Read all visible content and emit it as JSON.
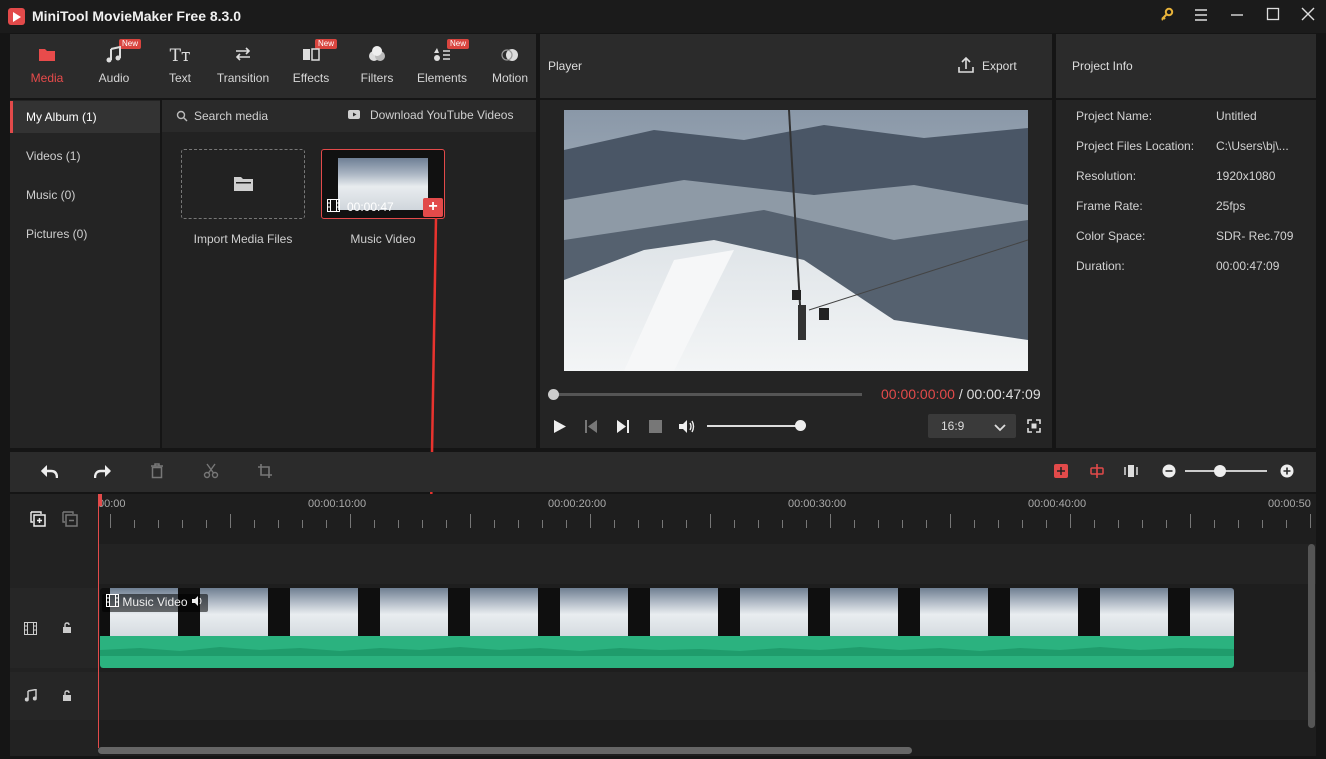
{
  "window": {
    "title": "MiniTool MovieMaker Free 8.3.0"
  },
  "toolbar": {
    "tabs": [
      {
        "label": "Media",
        "icon": "folder-icon",
        "new": false,
        "active": true
      },
      {
        "label": "Audio",
        "icon": "music-note-icon",
        "new": true,
        "active": false
      },
      {
        "label": "Text",
        "icon": "text-icon",
        "new": false,
        "active": false
      },
      {
        "label": "Transition",
        "icon": "transition-icon",
        "new": false,
        "active": false
      },
      {
        "label": "Effects",
        "icon": "effects-icon",
        "new": true,
        "active": false
      },
      {
        "label": "Filters",
        "icon": "filters-icon",
        "new": false,
        "active": false
      },
      {
        "label": "Elements",
        "icon": "elements-icon",
        "new": true,
        "active": false
      },
      {
        "label": "Motion",
        "icon": "motion-icon",
        "new": false,
        "active": false
      }
    ],
    "new_badge": "New"
  },
  "sidebar": {
    "items": [
      {
        "label": "My Album (1)",
        "active": true
      },
      {
        "label": "Videos (1)",
        "active": false
      },
      {
        "label": "Music (0)",
        "active": false
      },
      {
        "label": "Pictures (0)",
        "active": false
      }
    ]
  },
  "media": {
    "search_label": "Search media",
    "download_label": "Download YouTube Videos",
    "import_label": "Import Media Files",
    "clip_label": "Music Video",
    "clip_duration": "00:00:47"
  },
  "player": {
    "title": "Player",
    "export_label": "Export",
    "current_time": "00:00:00:00",
    "separator": " / ",
    "total_time": "00:00:47:09",
    "aspect_ratio": "16:9",
    "progress": 0.0,
    "volume": 1.0
  },
  "project_info": {
    "title": "Project Info",
    "rows": [
      {
        "key": "Project Name:",
        "value": "Untitled"
      },
      {
        "key": "Project Files Location:",
        "value": "C:\\Users\\bj\\..."
      },
      {
        "key": "Resolution:",
        "value": "1920x1080"
      },
      {
        "key": "Frame Rate:",
        "value": "25fps"
      },
      {
        "key": "Color Space:",
        "value": "SDR- Rec.709"
      },
      {
        "key": "Duration:",
        "value": "00:00:47:09"
      }
    ]
  },
  "timeline": {
    "ruler_labels": [
      "00:00",
      "00:00:10:00",
      "00:00:20:00",
      "00:00:30:00",
      "00:00:40:00",
      "00:00:50"
    ],
    "clip_label": "Music Video",
    "zoom_level": 0.6
  },
  "colors": {
    "accent": "#e24a4a",
    "waveform": "#2bb27f",
    "timecode_red": "#e24a4a"
  }
}
